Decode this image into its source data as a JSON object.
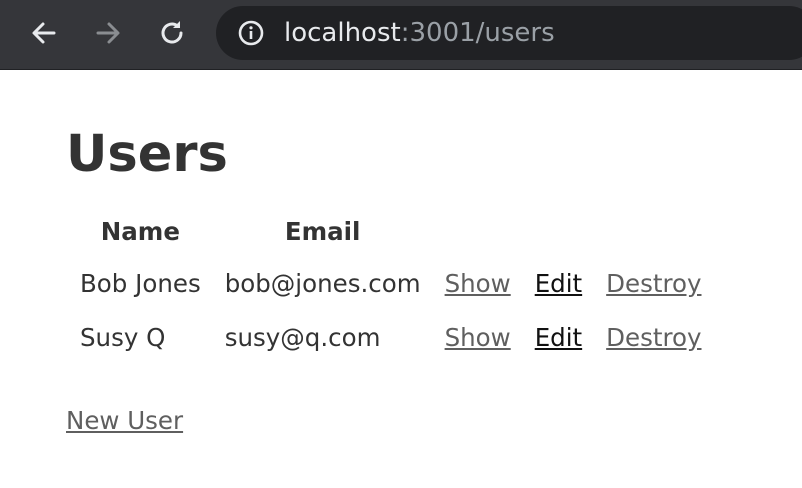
{
  "browser": {
    "url_host": "localhost",
    "url_path": ":3001/users",
    "icons": {
      "back": "arrow-left-icon",
      "forward": "arrow-right-icon",
      "reload": "reload-icon",
      "site_info": "info-icon"
    }
  },
  "page": {
    "title": "Users",
    "table": {
      "headers": [
        "Name",
        "Email",
        "",
        "",
        ""
      ],
      "rows": [
        {
          "name": "Bob Jones",
          "email": "bob@jones.com",
          "show": "Show",
          "edit": "Edit",
          "destroy": "Destroy"
        },
        {
          "name": "Susy Q",
          "email": "susy@q.com",
          "show": "Show",
          "edit": "Edit",
          "destroy": "Destroy"
        }
      ]
    },
    "new_user_link": "New User"
  },
  "colors": {
    "chrome_bg": "#35363a",
    "omnibox_bg": "#202124",
    "text": "#333333",
    "link": "#5f5f5f"
  }
}
